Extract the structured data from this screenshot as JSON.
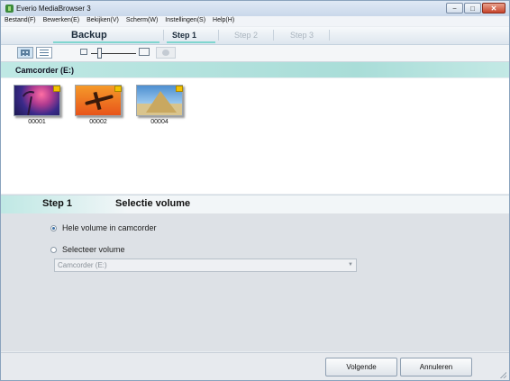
{
  "window": {
    "title": "Everio MediaBrowser 3",
    "controls": [
      "−",
      "□",
      "✕"
    ]
  },
  "menu": [
    "Bestand(F)",
    "Bewerken(E)",
    "Bekijken(V)",
    "Scherm(W)",
    "Instellingen(S)",
    "Help(H)"
  ],
  "stepbar": {
    "title": "Backup",
    "steps": [
      "Step 1",
      "Step 2",
      "Step 3"
    ],
    "active_step": 1
  },
  "toolbar": {
    "view_modes": [
      "grid-view-icon",
      "list-view-icon"
    ],
    "zoom_level": 0.2
  },
  "device": {
    "label": "Camcorder (E:)"
  },
  "thumbnails": [
    {
      "name": "00001",
      "icon": "palm-image"
    },
    {
      "name": "00002",
      "icon": "airplane-image"
    },
    {
      "name": "00004",
      "icon": "pyramid-image"
    }
  ],
  "step_section": {
    "step_label": "Step 1",
    "title": "Selectie volume"
  },
  "options": {
    "whole_volume": "Hele volume in camcorder",
    "select_volume": "Selecteer volume",
    "selected": "whole_volume",
    "volume_select_value": "Camcorder (E:)"
  },
  "footer": {
    "next_label": "Volgende",
    "cancel_label": "Annuleren"
  },
  "colors": {
    "accent": "#a9ddd8",
    "tab_active_line": "#7fd6cf"
  }
}
